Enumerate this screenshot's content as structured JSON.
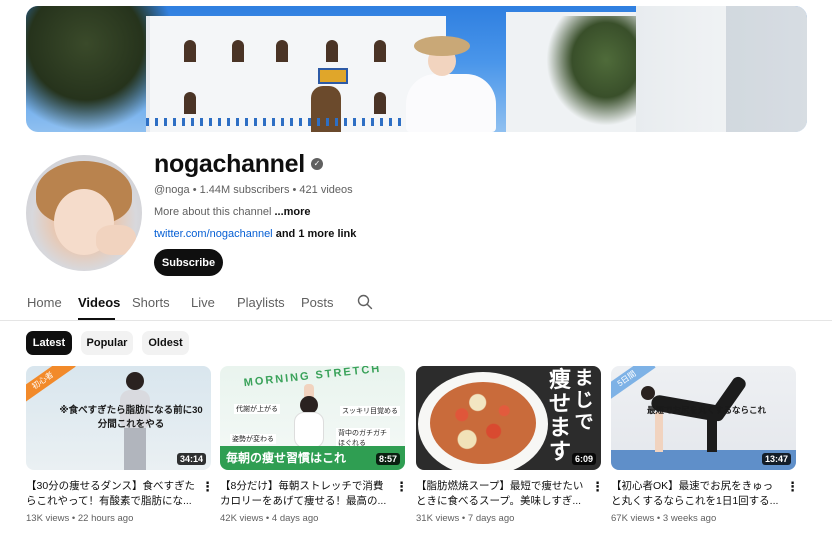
{
  "channel": {
    "name": "nogachannel",
    "meta": "@noga • 1.44M subscribers • 421 videos",
    "about": "More about this channel",
    "about_more": "...more",
    "link_primary": "twitter.com/nogachannel",
    "link_extra": "and 1 more link",
    "subscribe_label": "Subscribe"
  },
  "tabs": [
    "Home",
    "Videos",
    "Shorts",
    "Live",
    "Playlists",
    "Posts"
  ],
  "active_tab": "Videos",
  "chips": [
    "Latest",
    "Popular",
    "Oldest"
  ],
  "active_chip": "Latest",
  "videos": [
    {
      "title": "【30分の痩せるダンス】食べすぎたらこれやって！有酸素で脂肪にな...",
      "duration": "34:14",
      "stats": "13K views • 22 hours ago",
      "thumb_text": "※食べすぎたら脂肪になる前に30分間これをやる",
      "thumb_corner": "初心者"
    },
    {
      "title": "【8分だけ】毎朝ストレッチで消費カロリーをあげて痩せる！最高の...",
      "duration": "8:57",
      "stats": "42K views • 4 days ago",
      "thumb_arc": "MORNING STRETCH",
      "thumb_bar": "毎朝の痩せ習慣はこれ",
      "thumb_labels": [
        "代謝が上がる",
        "スッキリ目覚める",
        "姿勢が変わる",
        "背中のガチガチほぐれる"
      ]
    },
    {
      "title": "【脂肪燃焼スープ】最短で痩せたいときに食べるスープ。美味しすぎ...",
      "duration": "6:09",
      "stats": "31K views • 7 days ago",
      "thumb_vtext_1": "まじで",
      "thumb_vtext_2": "痩せます"
    },
    {
      "title": "【初心者OK】最速でお尻をきゅっと丸くするならこれを1日1回する...",
      "duration": "13:47",
      "stats": "67K views • 3 weeks ago",
      "thumb_text": "最短でお尻を丸くするならこれ",
      "thumb_corner": "5日間"
    }
  ],
  "icons": {
    "verified": "verified-check-icon",
    "search": "search-icon",
    "menu": "more-vert-icon"
  },
  "colors": {
    "text": "#0f0f0f",
    "secondary": "#606060",
    "link": "#065fd4",
    "subscribe_bg": "#0f0f0f"
  }
}
